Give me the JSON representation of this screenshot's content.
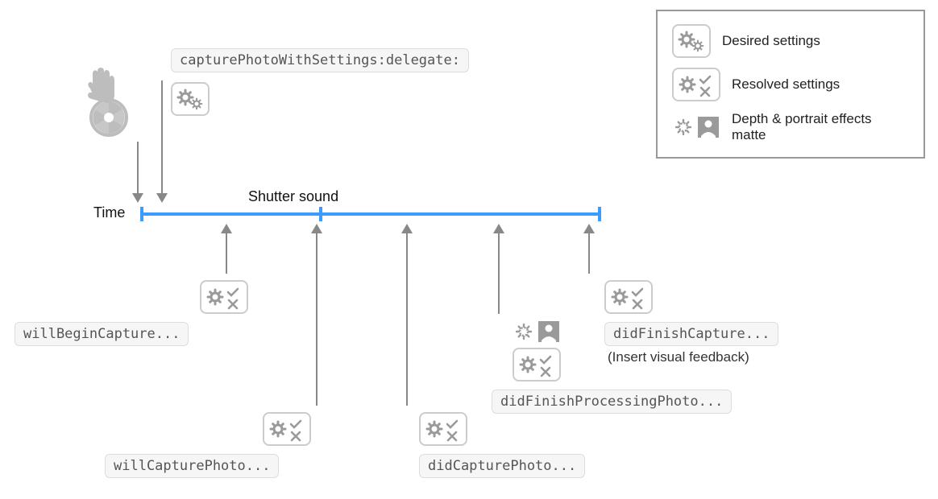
{
  "timeline": {
    "axis_label": "Time",
    "top_label": "Shutter sound",
    "feedback_note": "(Insert visual feedback)"
  },
  "top_call": {
    "label": "capturePhotoWithSettings:delegate:"
  },
  "callbacks": {
    "willBeginCapture": "willBeginCapture...",
    "willCapturePhoto": "willCapturePhoto...",
    "didCapturePhoto": "didCapturePhoto...",
    "didFinishProcessingPhoto": "didFinishProcessingPhoto...",
    "didFinishCapture": "didFinishCapture..."
  },
  "legend": {
    "desired": "Desired settings",
    "resolved": "Resolved settings",
    "depth": "Depth & portrait effects matte"
  },
  "icons": {
    "desired": "gears-icon",
    "resolved": "gears-check-x-icon",
    "depth": "depth-portrait-icon",
    "touch": "touch-shutter-icon"
  }
}
